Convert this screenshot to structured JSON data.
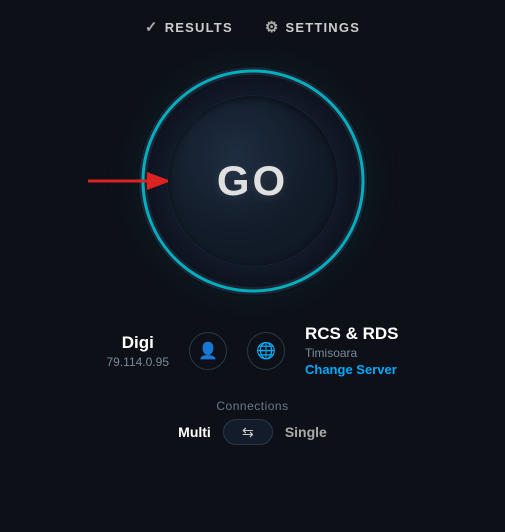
{
  "nav": {
    "results_label": "RESULTS",
    "settings_label": "SETTINGS"
  },
  "speedtest": {
    "go_label": "GO"
  },
  "isp": {
    "name": "Digi",
    "ip": "79.114.0.95"
  },
  "server": {
    "name": "RCS & RDS",
    "location": "Timisoara",
    "change_label": "Change Server"
  },
  "connections": {
    "label": "Connections",
    "multi_label": "Multi",
    "single_label": "Single"
  }
}
